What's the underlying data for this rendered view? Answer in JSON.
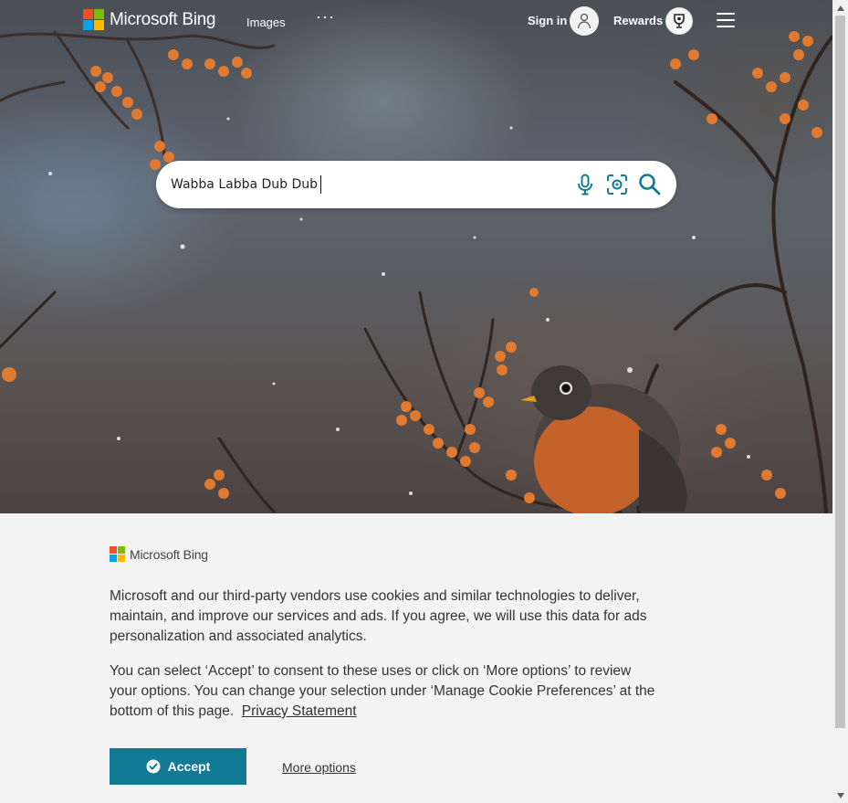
{
  "header": {
    "brand": "Microsoft Bing",
    "nav_images": "Images",
    "nav_more": "···",
    "sign_in": "Sign in",
    "rewards": "Rewards"
  },
  "search": {
    "value": "Wabba Labba Dub Dub",
    "icons": [
      "microphone-icon",
      "visual-search-icon",
      "search-icon"
    ]
  },
  "consent": {
    "brand": "Microsoft Bing",
    "paragraph1": "Microsoft and our third-party vendors use cookies and similar technologies to deliver, maintain, and improve our services and ads. If you agree, we will use this data for ads personalization and associated analytics.",
    "paragraph2": "You can select ‘Accept’ to consent to these uses or click on ‘More options’ to review your options.  You can change your selection under ‘Manage Cookie Preferences’ at the bottom of this page.",
    "privacy_link": "Privacy Statement",
    "accept_label": "Accept",
    "more_options_label": "More options"
  },
  "colors": {
    "accent": "#137a96",
    "search_icon": "#137a96"
  }
}
